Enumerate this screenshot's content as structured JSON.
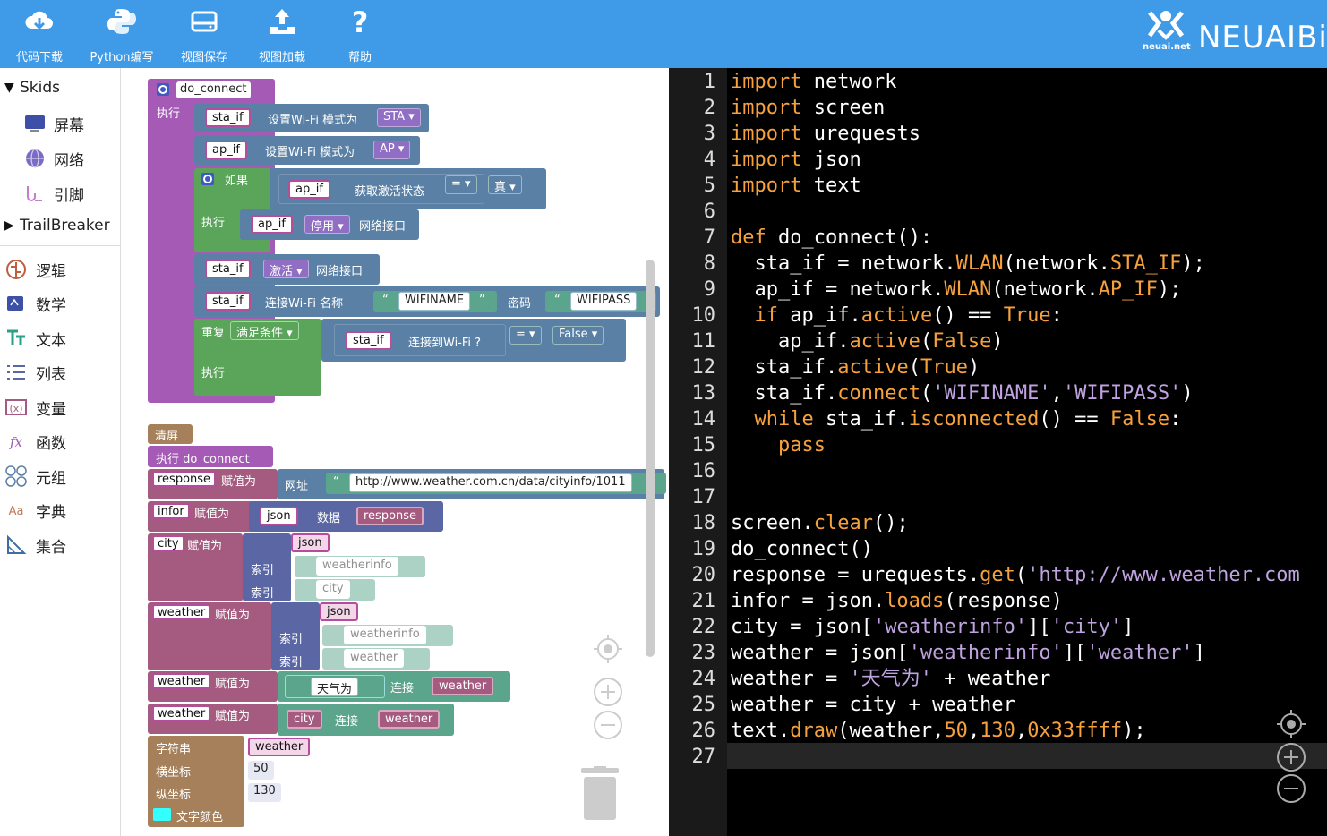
{
  "toolbar": {
    "items": [
      {
        "label": "代码下载",
        "icon": "cloud-download-icon"
      },
      {
        "label": "Python编写",
        "icon": "python-icon"
      },
      {
        "label": "视图保存",
        "icon": "drive-save-icon"
      },
      {
        "label": "视图加载",
        "icon": "upload-icon"
      },
      {
        "label": "帮助",
        "icon": "help-icon"
      }
    ],
    "brand_small": "neuai.net",
    "brand_name": "NEUAIBit"
  },
  "sidebar": {
    "skids": "Skids",
    "trailbreaker": "TrailBreaker",
    "skid_items": [
      "屏幕",
      "网络",
      "引脚"
    ],
    "categories": [
      "逻辑",
      "数学",
      "文本",
      "列表",
      "变量",
      "函数",
      "元组",
      "字典",
      "集合"
    ]
  },
  "blocks": {
    "func_name": "do_connect",
    "exec": "执行",
    "sta_if": "sta_if",
    "ap_if": "ap_if",
    "set_wifi_mode": "设置Wi-Fi  模式为",
    "sta": "STA",
    "ap": "AP",
    "if": "如果",
    "get_active": "获取激活状态",
    "eq": "=",
    "true": "真",
    "disable": "停用",
    "net_iface": "网络接口",
    "activate": "激活",
    "connect_wifi_name": "连接Wi-Fi  名称",
    "wifiname": "WIFINAME",
    "password": "密码",
    "wifipass": "WIFIPASS",
    "repeat": "重复",
    "until": "满足条件",
    "connected": "连接到Wi-Fi  ?",
    "false": "False",
    "clear": "清屏",
    "exec_do_connect": "执行  do_connect",
    "response": "response",
    "assign": "赋值为",
    "url_label": "网址",
    "url": "http://www.weather.com.cn/data/cityinfo/1011",
    "infor": "infor",
    "json": "json",
    "data": "数据",
    "city": "city",
    "index": "索引",
    "weatherinfo": "weatherinfo",
    "weather": "weather",
    "tianqiwei": "天气为",
    "concat": "连接",
    "string": "字符串",
    "xcoord": "横坐标",
    "ycoord": "纵坐标",
    "x": "50",
    "y": "130",
    "textcolor": "文字颜色"
  },
  "colors": {
    "toolbar": "#3f9ae8",
    "func_block": "#a55ab5",
    "network_block": "#5b80a5",
    "logic_block": "#5ba55b",
    "screen_block": "#a5805b",
    "text_block": "#5ba58c",
    "var_block": "#a55b80",
    "text_color_swatch": "#33ffff"
  },
  "code": [
    "import network",
    "import screen",
    "import urequests",
    "import json",
    "import text",
    "",
    "def do_connect():",
    "  sta_if = network.WLAN(network.STA_IF);",
    "  ap_if = network.WLAN(network.AP_IF);",
    "  if ap_if.active() == True:",
    "    ap_if.active(False)",
    "  sta_if.active(True)",
    "  sta_if.connect('WIFINAME','WIFIPASS')",
    "  while sta_if.isconnected() == False:",
    "    pass",
    "",
    "",
    "screen.clear();",
    "do_connect()",
    "response = urequests.get('http://www.weather.com",
    "infor = json.loads(response)",
    "city = json['weatherinfo']['city']",
    "weather = json['weatherinfo']['weather']",
    "weather = '天气为' + weather",
    "weather = city + weather",
    "text.draw(weather,50,130,0x33ffff);",
    ""
  ]
}
